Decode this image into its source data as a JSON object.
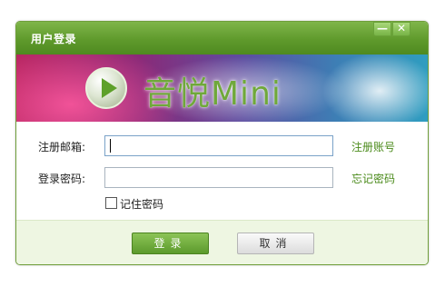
{
  "window": {
    "title": "用户登录",
    "minimize_symbol": "—",
    "close_symbol": "✕"
  },
  "banner": {
    "logo_icon": "play-icon",
    "logo_text": "音悦Mini"
  },
  "form": {
    "email_label": "注册邮箱:",
    "email_value": "",
    "password_label": "登录密码:",
    "password_value": "",
    "register_link": "注册账号",
    "forgot_link": "忘记密码",
    "remember_label": "记住密码",
    "remember_checked": false
  },
  "buttons": {
    "login": "登录",
    "cancel": "取消"
  },
  "colors": {
    "accent_green": "#5f9a2c",
    "link_green": "#4a8a1a",
    "footer_bg": "#eef6e2"
  }
}
